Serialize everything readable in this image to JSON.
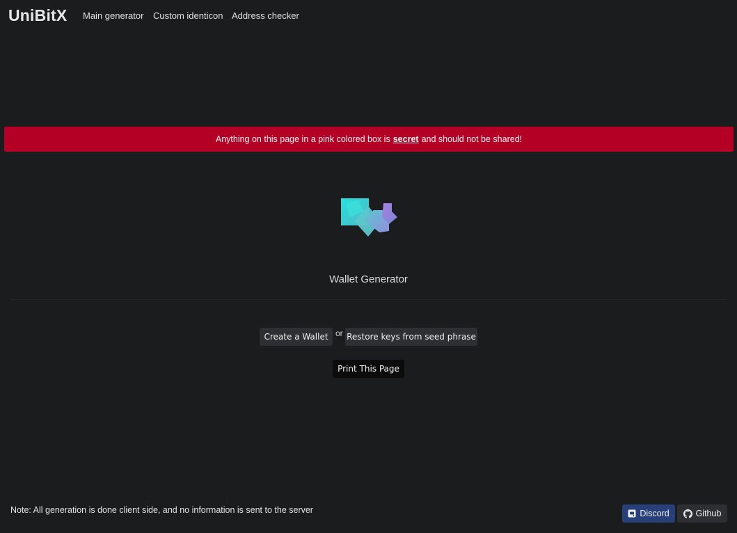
{
  "navbar": {
    "brand": "UniBitX",
    "links": [
      "Main generator",
      "Custom identicon",
      "Address checker"
    ]
  },
  "banner": {
    "text_before": "Anything on this page in a pink colored box is",
    "emphasis": "secret",
    "text_after": "and should not be shared!",
    "color": "#b30024"
  },
  "identicon": {
    "icon": "identicon-icon",
    "colors": [
      "#2fd6d0",
      "#7ab8d8",
      "#9d7ad6"
    ]
  },
  "main": {
    "title": "Wallet Generator",
    "create_label": "Create a Wallet",
    "or_label": "or",
    "restore_label": "Restore keys from seed phrase",
    "print_label": "Print This Page"
  },
  "footer": {
    "note": "Note: All generation is done client side, and no information is sent to the server",
    "discord_label": "Discord",
    "discord_icon": "discord-icon",
    "discord_color": "#27407a",
    "github_label": "Github",
    "github_icon": "github-icon"
  }
}
